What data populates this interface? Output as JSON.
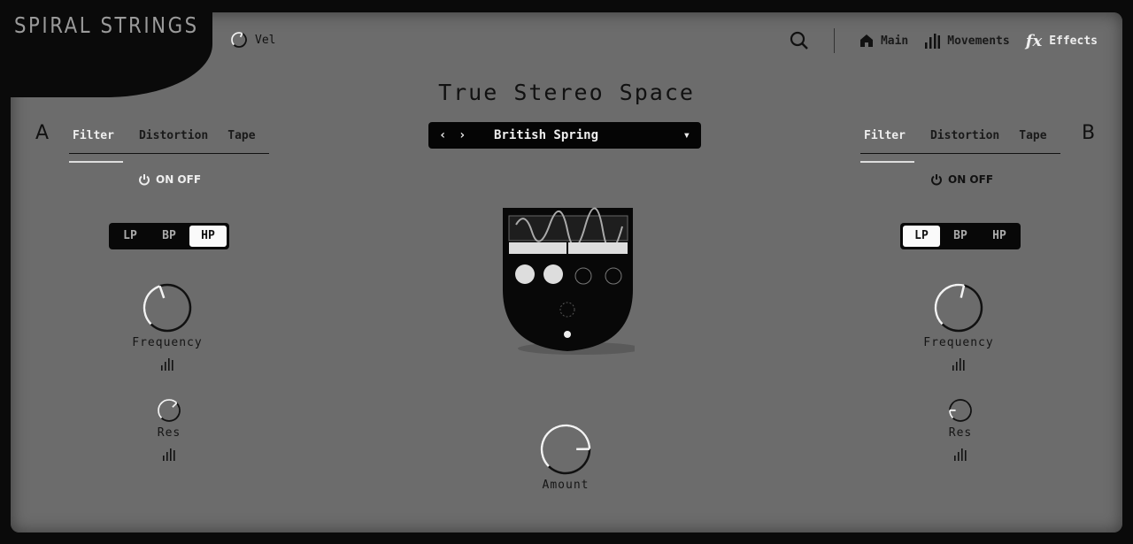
{
  "header": {
    "logo": "SPIRAL STRINGS",
    "vel_label": "Vel",
    "vel_value": 0.6,
    "nav": [
      {
        "label": "Main",
        "icon": "home-icon"
      },
      {
        "label": "Movements",
        "icon": "bars-icon"
      },
      {
        "label": "Effects",
        "icon": "fx-icon",
        "active": true
      }
    ],
    "fx_glyph": "fx"
  },
  "title": "True Stereo Space",
  "preset": {
    "prev": "‹",
    "next": "›",
    "name": "British Spring",
    "dropdown": "▾"
  },
  "side_a": {
    "letter": "A",
    "tabs": [
      "Filter",
      "Distortion",
      "Tape"
    ],
    "active_tab": "Filter",
    "power_label": "ON OFF",
    "modes": [
      "LP",
      "BP",
      "HP"
    ],
    "selected_mode": "HP",
    "frequency": {
      "label": "Frequency",
      "value": 0.43
    },
    "res": {
      "label": "Res",
      "value": 0.67
    }
  },
  "side_b": {
    "letter": "B",
    "tabs": [
      "Filter",
      "Distortion",
      "Tape"
    ],
    "active_tab": "Filter",
    "power_label": "ON OFF",
    "modes": [
      "LP",
      "BP",
      "HP"
    ],
    "selected_mode": "LP",
    "frequency": {
      "label": "Frequency",
      "value": 0.55
    },
    "res": {
      "label": "Res",
      "value": 0.17
    }
  },
  "amount": {
    "label": "Amount",
    "value": 0.83
  }
}
